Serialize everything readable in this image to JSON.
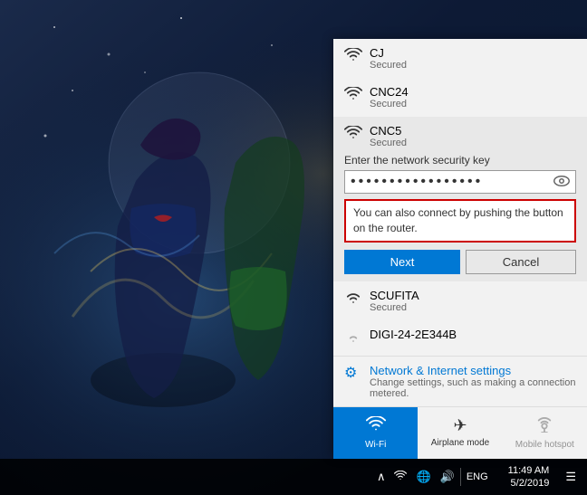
{
  "wallpaper": {
    "description": "Anime game character wallpaper background"
  },
  "wifi_panel": {
    "networks": [
      {
        "id": "cj",
        "name": "CJ",
        "status": "Secured",
        "expanded": false
      },
      {
        "id": "cnc24",
        "name": "CNC24",
        "status": "Secured",
        "expanded": false
      },
      {
        "id": "cnc5",
        "name": "CNC5",
        "status": "Secured",
        "expanded": true,
        "security_key_label": "Enter the network security key",
        "password_placeholder": "••••••••••••••••",
        "wps_hint": "You can also connect by pushing the button on the router.",
        "next_button": "Next",
        "cancel_button": "Cancel"
      }
    ],
    "more_networks": [
      {
        "id": "scufita",
        "name": "SCUFITA",
        "status": "Secured"
      },
      {
        "id": "digi",
        "name": "DIGI-24-2E344B",
        "status": ""
      }
    ],
    "settings": {
      "title": "Network & Internet settings",
      "description": "Change settings, such as making a connection metered."
    },
    "quick_actions": [
      {
        "id": "wifi",
        "label": "Wi-Fi",
        "icon": "wifi",
        "active": true
      },
      {
        "id": "airplane",
        "label": "Airplane mode",
        "icon": "airplane",
        "active": false
      },
      {
        "id": "mobile-hotspot",
        "label": "Mobile hotspot",
        "icon": "hotspot",
        "active": false
      }
    ]
  },
  "taskbar": {
    "system_tray": {
      "icons": [
        "chevron-up",
        "wifi",
        "globe",
        "volume"
      ],
      "language": "ENG",
      "time": "11:49 AM",
      "date": "5/2/2019",
      "notification_icon": "☰"
    }
  }
}
